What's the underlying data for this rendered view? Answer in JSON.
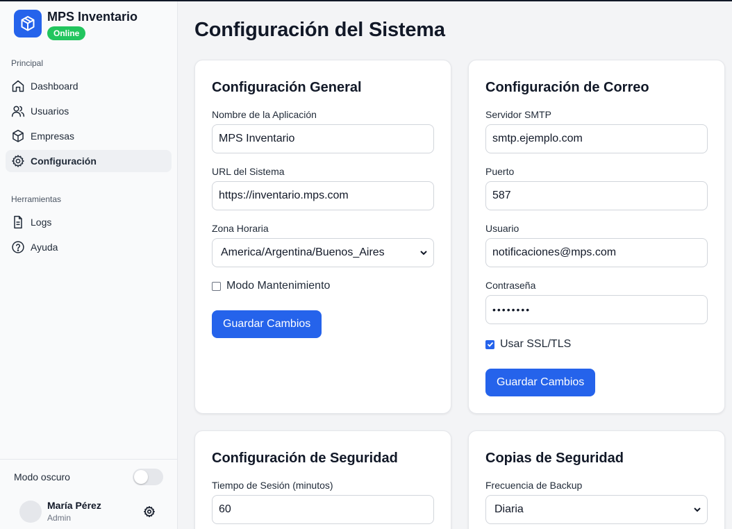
{
  "app": {
    "name": "MPS Inventario",
    "status": "Online"
  },
  "sidebar": {
    "section_main": "Principal",
    "main_items": [
      {
        "label": "Dashboard",
        "icon": "home-icon"
      },
      {
        "label": "Usuarios",
        "icon": "users-icon"
      },
      {
        "label": "Empresas",
        "icon": "box-icon"
      },
      {
        "label": "Configuración",
        "icon": "gear-icon",
        "active": true
      }
    ],
    "section_tools": "Herramientas",
    "tool_items": [
      {
        "label": "Logs",
        "icon": "file-text-icon"
      },
      {
        "label": "Ayuda",
        "icon": "help-circle-icon"
      }
    ],
    "dark_mode_label": "Modo oscuro",
    "dark_mode_on": false,
    "user": {
      "name": "María Pérez",
      "role": "Admin"
    }
  },
  "page": {
    "title": "Configuración del Sistema"
  },
  "general": {
    "title": "Configuración General",
    "app_name_label": "Nombre de la Aplicación",
    "app_name_value": "MPS Inventario",
    "url_label": "URL del Sistema",
    "url_value": "https://inventario.mps.com",
    "timezone_label": "Zona Horaria",
    "timezone_value": "America/Argentina/Buenos_Aires",
    "maintenance_label": "Modo Mantenimiento",
    "maintenance_checked": false,
    "save_label": "Guardar Cambios"
  },
  "mail": {
    "title": "Configuración de Correo",
    "smtp_label": "Servidor SMTP",
    "smtp_value": "smtp.ejemplo.com",
    "port_label": "Puerto",
    "port_value": "587",
    "user_label": "Usuario",
    "user_value": "notificaciones@mps.com",
    "password_label": "Contraseña",
    "password_value": "••••••••",
    "ssl_label": "Usar SSL/TLS",
    "ssl_checked": true,
    "save_label": "Guardar Cambios"
  },
  "security": {
    "title": "Configuración de Seguridad",
    "session_label": "Tiempo de Sesión (minutos)",
    "session_value": "60"
  },
  "backup": {
    "title": "Copias de Seguridad",
    "frequency_label": "Frecuencia de Backup",
    "frequency_value": "Diaria"
  },
  "colors": {
    "accent": "#2563eb",
    "online": "#22c55e"
  }
}
